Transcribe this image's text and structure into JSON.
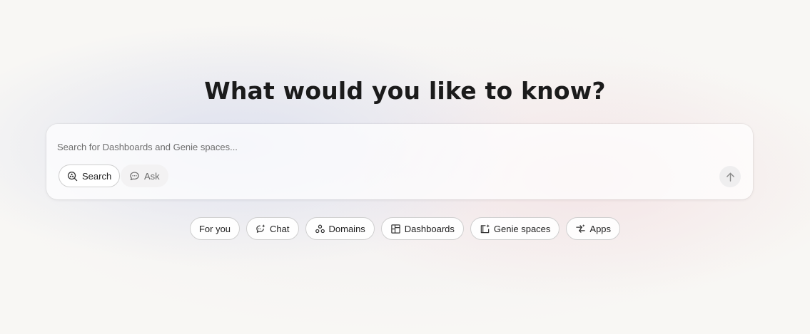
{
  "heading": "What would you like to know?",
  "search": {
    "placeholder": "Search for Dashboards and Genie spaces...",
    "value": ""
  },
  "modes": {
    "search_label": "Search",
    "ask_label": "Ask",
    "selected": "Search"
  },
  "submit": {
    "icon": "arrow-up-icon"
  },
  "chips": [
    {
      "label": "For you",
      "icon": null
    },
    {
      "label": "Chat",
      "icon": "chat-sparkle-icon"
    },
    {
      "label": "Domains",
      "icon": "domains-icon"
    },
    {
      "label": "Dashboards",
      "icon": "dashboard-icon"
    },
    {
      "label": "Genie spaces",
      "icon": "genie-space-icon"
    },
    {
      "label": "Apps",
      "icon": "apps-icon"
    }
  ],
  "colors": {
    "background": "#f8f7f4",
    "text": "#1f1f1f",
    "border": "#cfcfcf",
    "muted": "#6a6a6a"
  }
}
